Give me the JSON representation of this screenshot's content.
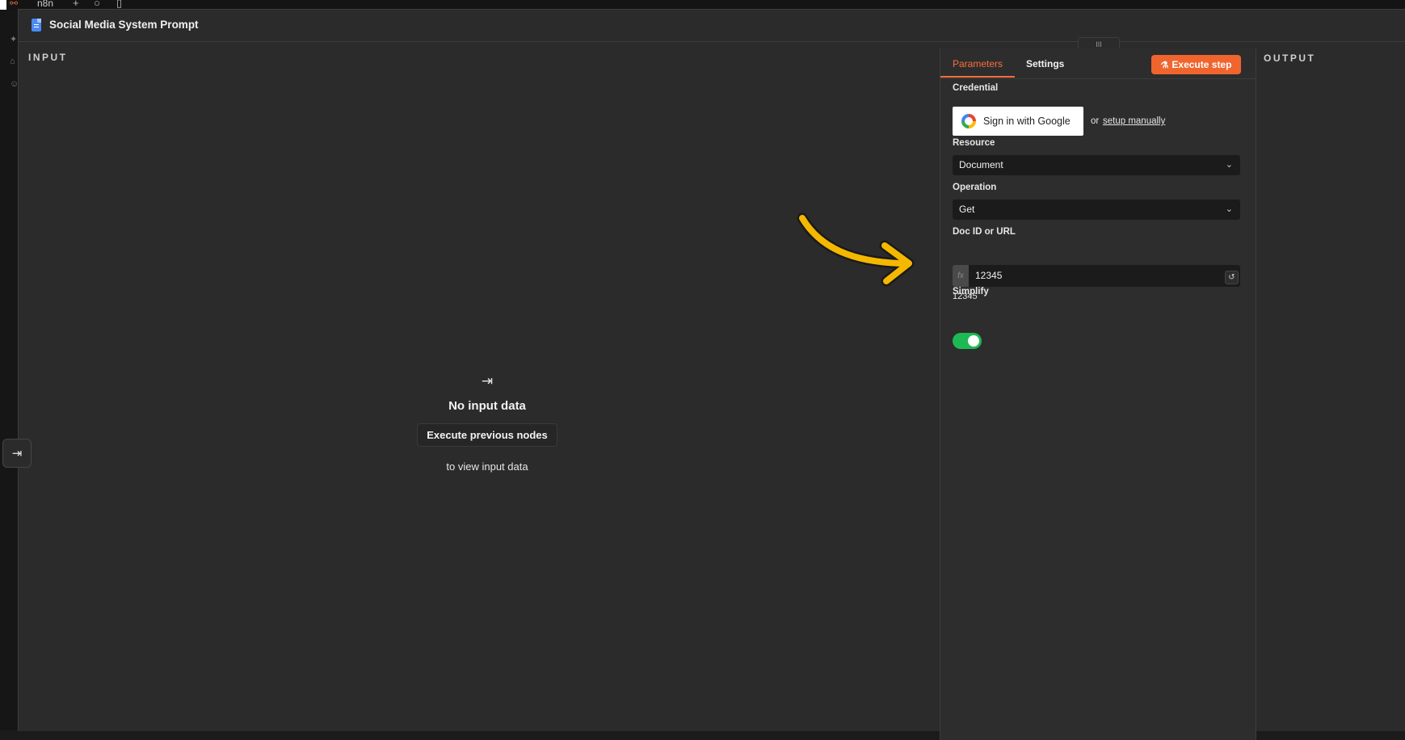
{
  "app": {
    "name": "n8n"
  },
  "modal": {
    "title": "Social Media System Prompt",
    "input_label": "INPUT",
    "output_label": "OUTPUT"
  },
  "input_panel": {
    "empty_icon": "input-arrow-icon",
    "no_data_title": "No input data",
    "execute_previous_label": "Execute previous nodes",
    "view_hint": "to view input data"
  },
  "tabs": [
    {
      "label": "Parameters",
      "active": true
    },
    {
      "label": "Settings",
      "active": false
    }
  ],
  "execute_step_label": "Execute step",
  "fields": {
    "credential": {
      "label": "Credential",
      "google_button": "Sign in with Google",
      "or": "or",
      "setup_link": "setup manually"
    },
    "resource": {
      "label": "Resource",
      "value": "Document"
    },
    "operation": {
      "label": "Operation",
      "value": "Get"
    },
    "doc_id": {
      "label": "Doc ID or URL",
      "value": "12345",
      "preview": "12345",
      "fx": "fx"
    },
    "simplify": {
      "label": "Simplify",
      "enabled": true
    }
  },
  "colors": {
    "accent": "#ff6d3a",
    "execute_button": "#f0652e",
    "toggle_on": "#1db954",
    "annotation_arrow": "#f5b800"
  }
}
